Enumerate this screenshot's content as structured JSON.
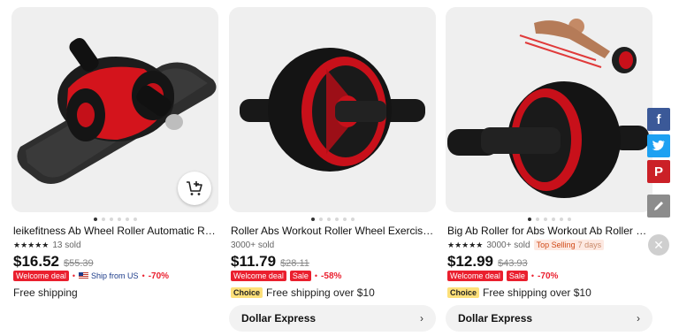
{
  "products": [
    {
      "title": "leikefitness Ab Wheel Roller Automatic Reb…",
      "stars": "★★★★★",
      "sold": "13 sold",
      "price": "$16.52",
      "old_price": "$55.39",
      "deal": "Welcome deal",
      "sep": "•",
      "ship_from": "Ship from US",
      "sep2": "•",
      "discount": "-70%",
      "shipping": "Free shipping",
      "cart_icon": "add-to-cart-icon"
    },
    {
      "title": "Roller Abs Workout Roller Wheel Exercise E…",
      "sold": "3000+ sold",
      "price": "$11.79",
      "old_price": "$28.11",
      "deal": "Welcome deal",
      "sale": "Sale",
      "sep": "•",
      "discount": "-58%",
      "choice": "Choice",
      "shipping": "Free shipping over $10",
      "store": "Dollar Express",
      "store_chevron": "›"
    },
    {
      "title": "Big Ab Roller for Abs Workout Ab Roller Wh…",
      "stars": "★★★★★",
      "sold": "3000+ sold",
      "top_selling": "Top Selling",
      "days": "7 days",
      "price": "$12.99",
      "old_price": "$43.93",
      "deal": "Welcome deal",
      "sale": "Sale",
      "sep": "•",
      "discount": "-70%",
      "choice": "Choice",
      "shipping": "Free shipping over $10",
      "store": "Dollar Express",
      "store_chevron": "›"
    }
  ],
  "share": {
    "facebook": "f",
    "pinterest": "P",
    "close": "✕",
    "icons": [
      "facebook-icon",
      "twitter-icon",
      "pinterest-icon",
      "pencil-icon",
      "close-icon"
    ]
  },
  "colors": {
    "accent_red": "#ea1f2e",
    "facebook": "#3b5998",
    "twitter": "#1da1f2",
    "pinterest": "#cb2027"
  }
}
